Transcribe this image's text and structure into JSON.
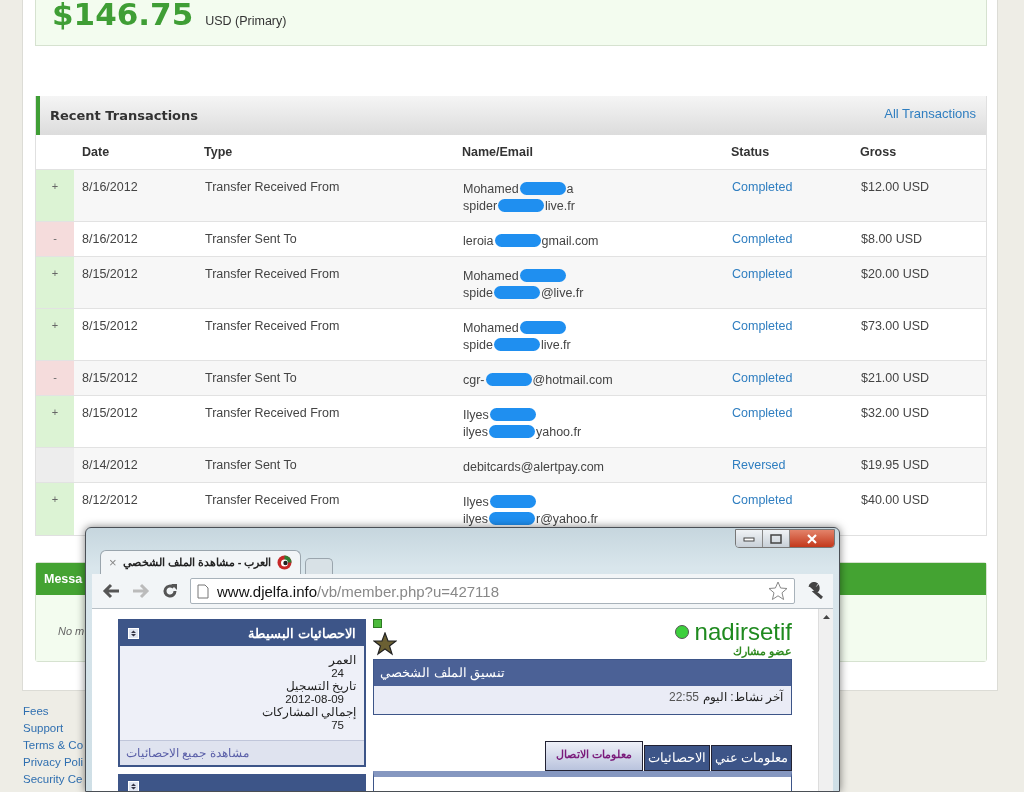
{
  "balance": {
    "amount": "$146.75",
    "currency": "USD (Primary)"
  },
  "transactions": {
    "title": "Recent Transactions",
    "link": "All Transactions",
    "columns": [
      "Date",
      "Type",
      "Name/Email",
      "Status",
      "Gross"
    ],
    "rows": [
      {
        "kind": "credit",
        "sign": "+",
        "date": "8/16/2012",
        "type": "Transfer Received From",
        "lines": [
          [
            {
              "kind": "text",
              "text": "Mohamed"
            },
            {
              "kind": "redaction"
            },
            {
              "kind": "text",
              "text": "a"
            }
          ],
          [
            {
              "kind": "text",
              "text": "spider"
            },
            {
              "kind": "redaction"
            },
            {
              "kind": "text",
              "text": "live.fr"
            }
          ]
        ],
        "status": "Completed",
        "gross": "$12.00 USD"
      },
      {
        "kind": "debit",
        "sign": "-",
        "date": "8/16/2012",
        "type": "Transfer Sent To",
        "lines": [
          [
            {
              "kind": "text",
              "text": "leroia"
            },
            {
              "kind": "redaction"
            },
            {
              "kind": "text",
              "text": "gmail.com"
            }
          ]
        ],
        "status": "Completed",
        "gross": "$8.00 USD"
      },
      {
        "kind": "credit",
        "sign": "+",
        "date": "8/15/2012",
        "type": "Transfer Received From",
        "lines": [
          [
            {
              "kind": "text",
              "text": "Mohamed"
            },
            {
              "kind": "redaction"
            }
          ],
          [
            {
              "kind": "text",
              "text": "spide"
            },
            {
              "kind": "redaction"
            },
            {
              "kind": "text",
              "text": "@live.fr"
            }
          ]
        ],
        "status": "Completed",
        "gross": "$20.00 USD"
      },
      {
        "kind": "credit",
        "sign": "+",
        "date": "8/15/2012",
        "type": "Transfer Received From",
        "lines": [
          [
            {
              "kind": "text",
              "text": "Mohamed"
            },
            {
              "kind": "redaction"
            }
          ],
          [
            {
              "kind": "text",
              "text": "spide"
            },
            {
              "kind": "redaction"
            },
            {
              "kind": "text",
              "text": "live.fr"
            }
          ]
        ],
        "status": "Completed",
        "gross": "$73.00 USD"
      },
      {
        "kind": "debit",
        "sign": "-",
        "date": "8/15/2012",
        "type": "Transfer Sent To",
        "lines": [
          [
            {
              "kind": "text",
              "text": "cgr-"
            },
            {
              "kind": "redaction"
            },
            {
              "kind": "text",
              "text": "@hotmail.com"
            }
          ]
        ],
        "status": "Completed",
        "gross": "$21.00 USD"
      },
      {
        "kind": "credit",
        "sign": "+",
        "date": "8/15/2012",
        "type": "Transfer Received From",
        "lines": [
          [
            {
              "kind": "text",
              "text": "Ilyes"
            },
            {
              "kind": "redaction"
            }
          ],
          [
            {
              "kind": "text",
              "text": "ilyes"
            },
            {
              "kind": "redaction"
            },
            {
              "kind": "text",
              "text": "yahoo.fr"
            }
          ]
        ],
        "status": "Completed",
        "gross": "$32.00 USD"
      },
      {
        "kind": "neutral",
        "date": "8/14/2012",
        "type": "Transfer Sent To",
        "lines": [
          [
            {
              "kind": "text",
              "text": "debitcards@alertpay.com"
            }
          ]
        ],
        "status": "Reversed",
        "gross": "$19.95 USD"
      },
      {
        "kind": "credit",
        "sign": "+",
        "date": "8/12/2012",
        "type": "Transfer Received From",
        "lines": [
          [
            {
              "kind": "text",
              "text": "Ilyes"
            },
            {
              "kind": "redaction"
            }
          ],
          [
            {
              "kind": "text",
              "text": "ilyes"
            },
            {
              "kind": "redaction"
            },
            {
              "kind": "text",
              "text": "r@yahoo.fr"
            }
          ]
        ],
        "status": "Completed",
        "gross": "$40.00 USD"
      }
    ]
  },
  "messages": {
    "title": "Messa",
    "empty_text": "No m"
  },
  "footer_links": [
    "Fees",
    "Support",
    "Terms & Co",
    "Privacy Poli",
    "Security Ce"
  ],
  "browser": {
    "tab": {
      "title": "العرب - مشاهدة الملف الشخصي",
      "close": "×",
      "selected": true
    },
    "url": {
      "host": "www.djelfa.info",
      "path": "/vb/member.php?u=427118"
    },
    "stats_panel": {
      "title": "الاحصائيات البسيطة",
      "fields": [
        {
          "label": "العمر",
          "value": "24"
        },
        {
          "label": "تاريخ التسجيل",
          "value": "2012-08-09"
        },
        {
          "label": "إجمالي المشاركات",
          "value": "75"
        }
      ],
      "footer_link": "مشاهدة جميع الاحصائيات"
    },
    "profile": {
      "username": "nadirsetif",
      "online": true,
      "rank": "عضو مشارك"
    },
    "profile_box": {
      "title": "تنسيق الملف الشخصي",
      "last_activity_label": "آخر نشاط: اليوم",
      "last_activity_time": "22:55"
    },
    "tabs": [
      {
        "label": "معلومات عني",
        "selected": false
      },
      {
        "label": "الاحصائيات",
        "selected": false
      },
      {
        "label": "معلومات الاتصال",
        "selected": true
      }
    ]
  }
}
